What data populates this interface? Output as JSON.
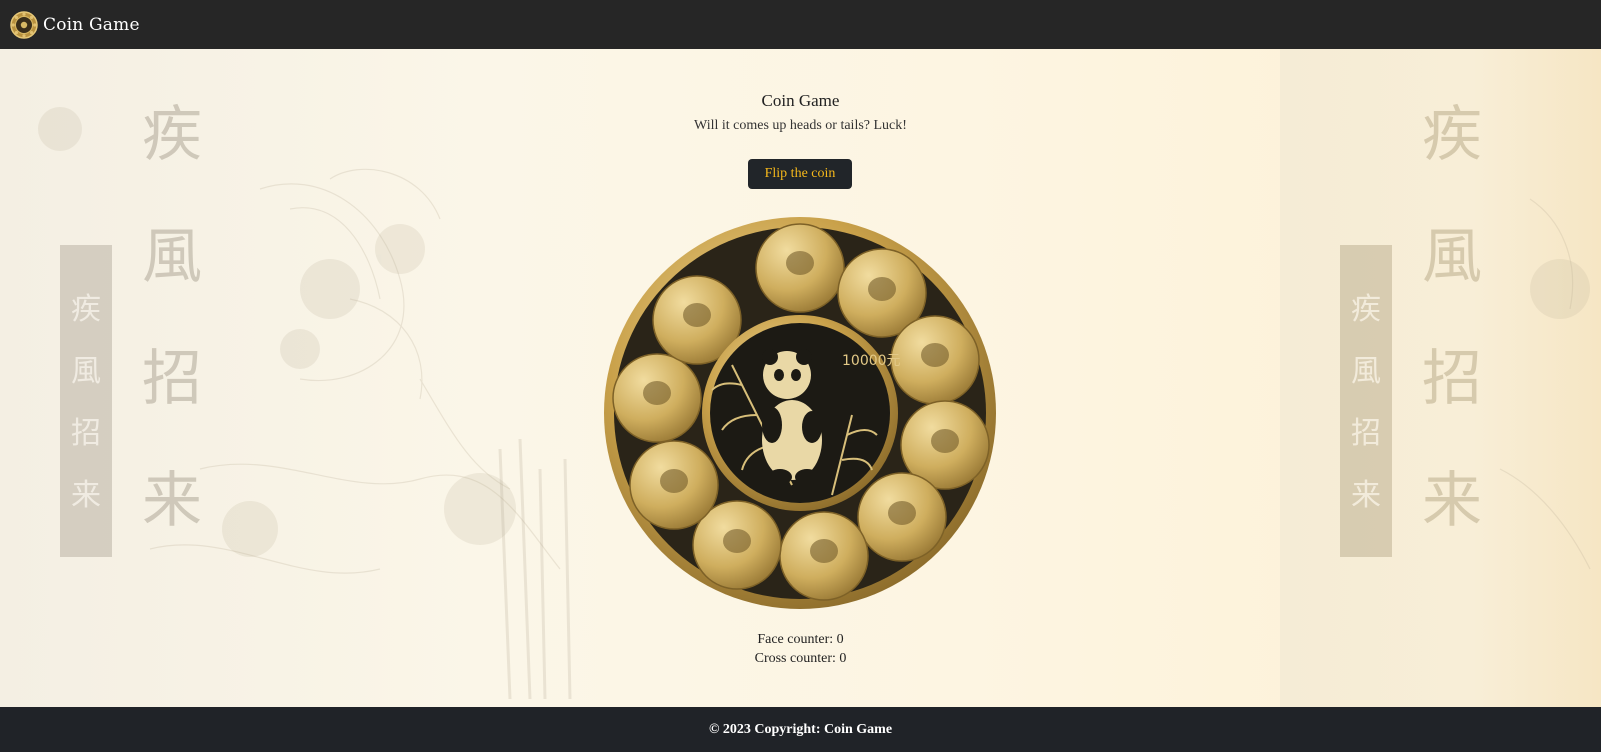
{
  "navbar": {
    "brand_text": "Coin Game"
  },
  "main": {
    "title": "Coin Game",
    "subtitle": "Will it comes up heads or tails? Luck!",
    "flip_button_label": "Flip the coin",
    "face_counter": "Face counter: 0",
    "cross_counter": "Cross counter: 0"
  },
  "decoration": {
    "calligraphy_large": [
      "疾",
      "風",
      "招",
      "来"
    ],
    "calligraphy_banner": [
      "疾",
      "風",
      "招",
      "来"
    ]
  },
  "coin": {
    "center_denomination": "10000元"
  },
  "footer": {
    "copyright": "© 2023 Copyright: Coin Game"
  },
  "colors": {
    "navbar_bg": "#262626",
    "footer_bg": "#202328",
    "button_bg": "#212529",
    "button_text": "#f5b81b",
    "gold": "#c9a14a"
  }
}
